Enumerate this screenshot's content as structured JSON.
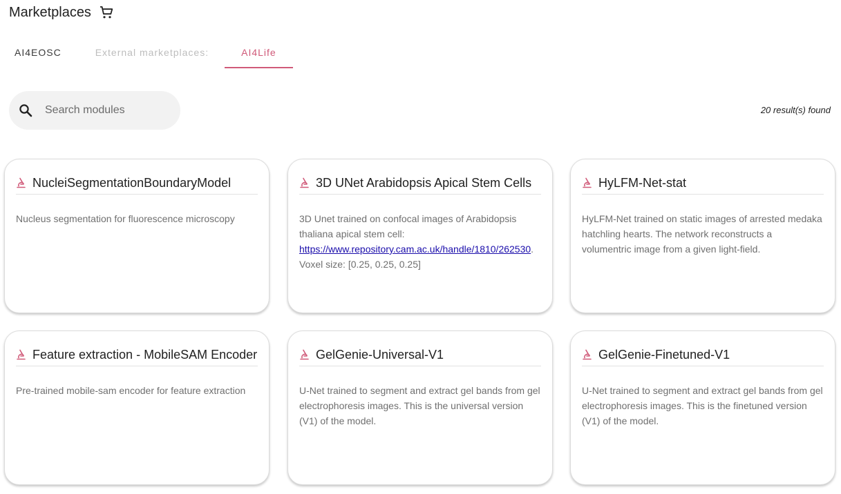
{
  "header": {
    "title": "Marketplaces",
    "icon": "cart-icon"
  },
  "tabs": [
    {
      "label": "AI4EOSC",
      "state": "normal"
    },
    {
      "label": "External marketplaces:",
      "state": "disabled"
    },
    {
      "label": "AI4Life",
      "state": "active"
    }
  ],
  "search": {
    "placeholder": "Search modules",
    "value": "",
    "icon": "search-icon"
  },
  "results": {
    "count_text": "20 result(s) found"
  },
  "colors": {
    "accent": "#d05a79",
    "link": "#1a0dab"
  },
  "cards": [
    {
      "title": "NucleiSegmentationBoundaryModel",
      "icon": "microscope-icon",
      "description": "Nucleus segmentation for fluorescence microscopy"
    },
    {
      "title": "3D UNet Arabidopsis Apical Stem Cells",
      "icon": "microscope-icon",
      "description_before": "3D Unet trained on confocal images of Arabidopsis thaliana apical stem cell: ",
      "description_link": "https://www.repository.cam.ac.uk/handle/1810/262530",
      "description_after": ". Voxel size: [0.25, 0.25, 0.25]"
    },
    {
      "title": "HyLFM-Net-stat",
      "icon": "microscope-icon",
      "description": "HyLFM-Net trained on static images of arrested medaka hatchling hearts. The network reconstructs a volumentric image from a given light-field."
    },
    {
      "title": "Feature extraction - MobileSAM Encoder",
      "icon": "microscope-icon",
      "description": "Pre-trained mobile-sam encoder for feature extraction"
    },
    {
      "title": "GelGenie-Universal-V1",
      "icon": "microscope-icon",
      "description": "U-Net trained to segment and extract gel bands from gel electrophoresis images. This is the universal version (V1) of the model."
    },
    {
      "title": "GelGenie-Finetuned-V1",
      "icon": "microscope-icon",
      "description": "U-Net trained to segment and extract gel bands from gel electrophoresis images. This is the finetuned version (V1) of the model."
    }
  ]
}
